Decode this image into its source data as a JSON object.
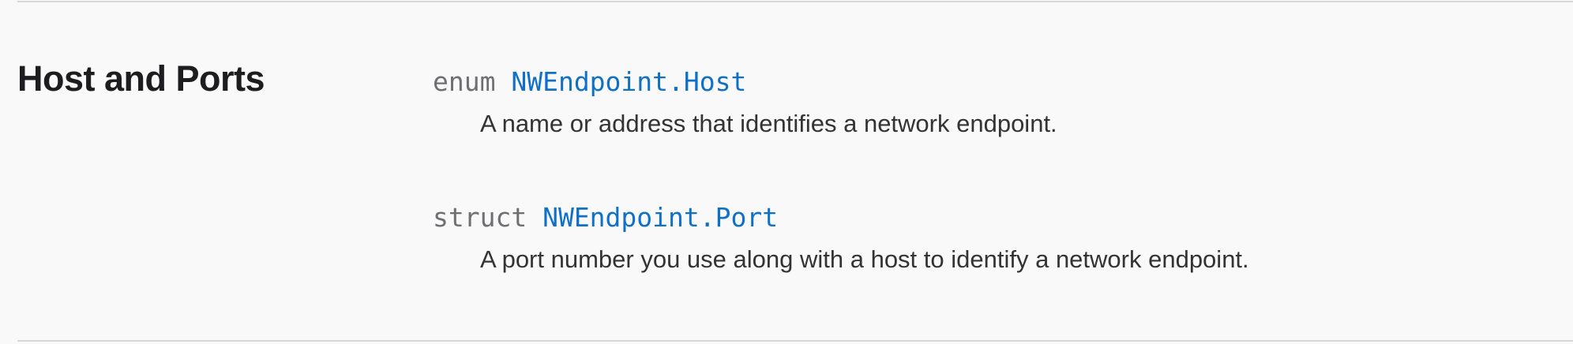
{
  "section": {
    "title": "Host and Ports"
  },
  "topics": [
    {
      "keyword": "enum",
      "symbol": "NWEndpoint.Host",
      "abstract": "A name or address that identifies a network endpoint."
    },
    {
      "keyword": "struct",
      "symbol": "NWEndpoint.Port",
      "abstract": "A port number you use along with a host to identify a network endpoint."
    }
  ],
  "colors": {
    "background": "#f9f9f9",
    "link": "#0f70c8",
    "keyword": "#6e6e73",
    "text": "#333333",
    "divider": "#d6d6d6"
  }
}
